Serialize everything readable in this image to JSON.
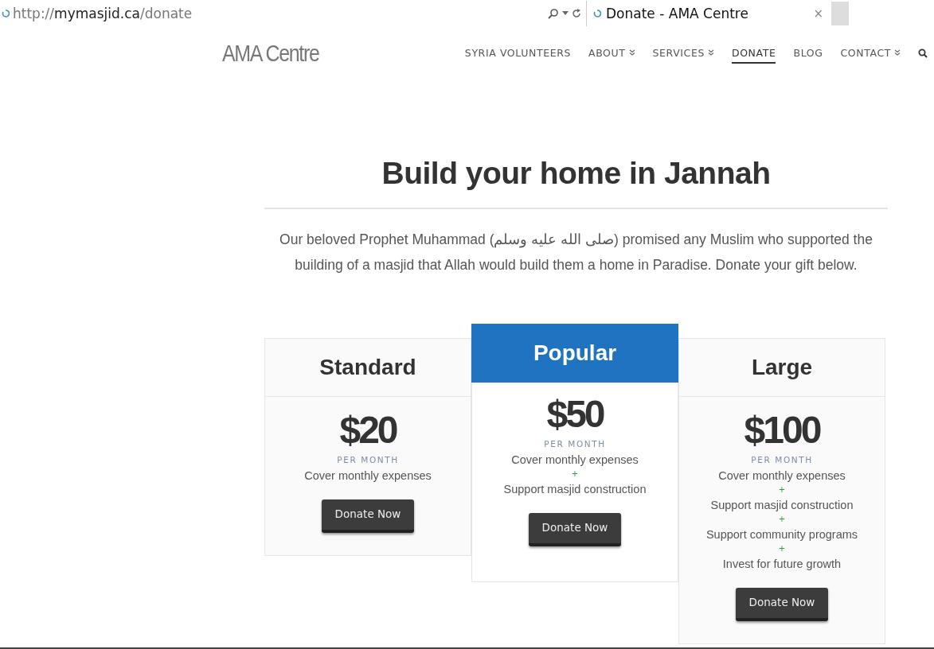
{
  "browser": {
    "url": {
      "scheme": "http://",
      "host": "mymasjid.ca",
      "path": "/donate"
    },
    "tab_title": "Donate - AMA Centre",
    "close": "×"
  },
  "site": {
    "logo": "AMA Centre",
    "nav": [
      {
        "label": "SYRIA VOLUNTEERS",
        "has_menu": false,
        "selected": false
      },
      {
        "label": "ABOUT",
        "has_menu": true,
        "selected": false
      },
      {
        "label": "SERVICES",
        "has_menu": true,
        "selected": false
      },
      {
        "label": "DONATE",
        "has_menu": false,
        "selected": true
      },
      {
        "label": "BLOG",
        "has_menu": false,
        "selected": false
      },
      {
        "label": "CONTACT",
        "has_menu": true,
        "selected": false
      }
    ]
  },
  "heading": "Build your home in Jannah",
  "intro": "Our beloved Prophet Muhammad (صلى الله عليه وسلم) promised any Muslim who supported the building of a masjid that Allah would build them a home in Paradise. Donate your gift below.",
  "plans": [
    {
      "name": "Standard",
      "featured": false,
      "price": "$20",
      "period": "PER MONTH",
      "features": [
        "Cover monthly expenses"
      ],
      "button": "Donate Now"
    },
    {
      "name": "Popular",
      "featured": true,
      "price": "$50",
      "period": "PER MONTH",
      "features": [
        "Cover monthly expenses",
        "Support masjid construction"
      ],
      "separator": "+",
      "button": "Donate Now"
    },
    {
      "name": "Large",
      "featured": false,
      "price": "$100",
      "period": "PER MONTH",
      "features": [
        "Cover monthly expenses",
        "Support masjid construction",
        "Support community programs",
        "Invest for future growth"
      ],
      "separator": "+",
      "button": "Donate Now"
    }
  ]
}
